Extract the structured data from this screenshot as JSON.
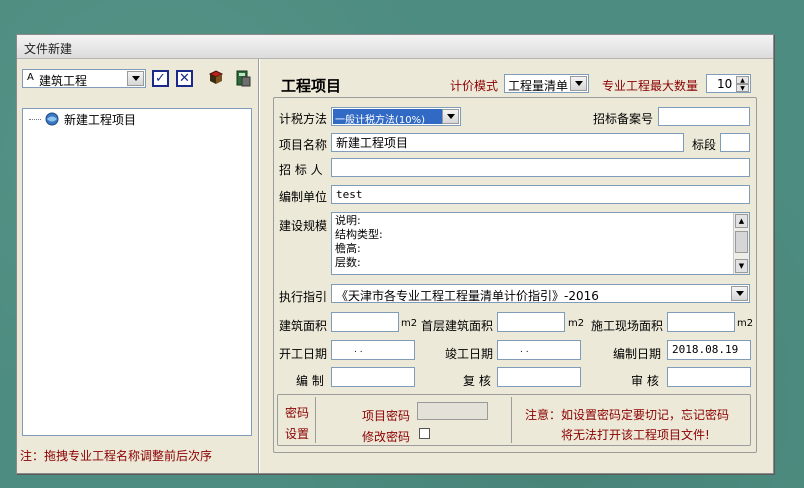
{
  "window": {
    "title": "文件新建"
  },
  "left": {
    "profession_select": {
      "prefix": "A",
      "value": "建筑工程"
    },
    "tree": [
      {
        "label": "新建工程项目"
      }
    ],
    "note": "注：拖拽专业工程名称调整前后次序"
  },
  "form": {
    "section_title": "工程项目",
    "pricing_mode": {
      "label": "计价模式",
      "value": "工程量清单"
    },
    "max_count": {
      "label": "专业工程最大数量",
      "value": "10"
    },
    "tax_method": {
      "label": "计税方法",
      "value": "一般计税方法(10%)"
    },
    "tender_record": {
      "label": "招标备案号",
      "value": ""
    },
    "project_name": {
      "label": "项目名称",
      "value": "新建工程项目"
    },
    "section": {
      "label": "标段",
      "value": ""
    },
    "tenderer": {
      "label": "招 标 人",
      "value": ""
    },
    "compiler_unit": {
      "label": "编制单位",
      "value": "test"
    },
    "scale": {
      "label": "建设规模",
      "lines": [
        "说明:",
        "结构类型:",
        "檐高:",
        "层数:"
      ]
    },
    "guideline": {
      "label": "执行指引",
      "value": "《天津市各专业工程工程量清单计价指引》-2016"
    },
    "building_area": {
      "label": "建筑面积",
      "value": "",
      "unit": "m2"
    },
    "first_floor_area": {
      "label": "首层建筑面积",
      "value": "",
      "unit": "m2"
    },
    "site_area": {
      "label": "施工现场面积",
      "value": "",
      "unit": "m2"
    },
    "start_date": {
      "label": "开工日期",
      "value": ".     ."
    },
    "finish_date": {
      "label": "竣工日期",
      "value": ".     ."
    },
    "compile_date": {
      "label": "编制日期",
      "value": "2018.08.19"
    },
    "compile": {
      "label": "编 制",
      "value": ""
    },
    "recheck": {
      "label": "复 核",
      "value": ""
    },
    "audit": {
      "label": "审 核",
      "value": ""
    },
    "password": {
      "group_label_1": "密码",
      "group_label_2": "设置",
      "project_password_label": "项目密码",
      "modify_password_label": "修改密码",
      "notice_line1": "注意：如设置密码定要切记，忘记密码",
      "notice_line2": "将无法打开该工程项目文件!"
    }
  }
}
